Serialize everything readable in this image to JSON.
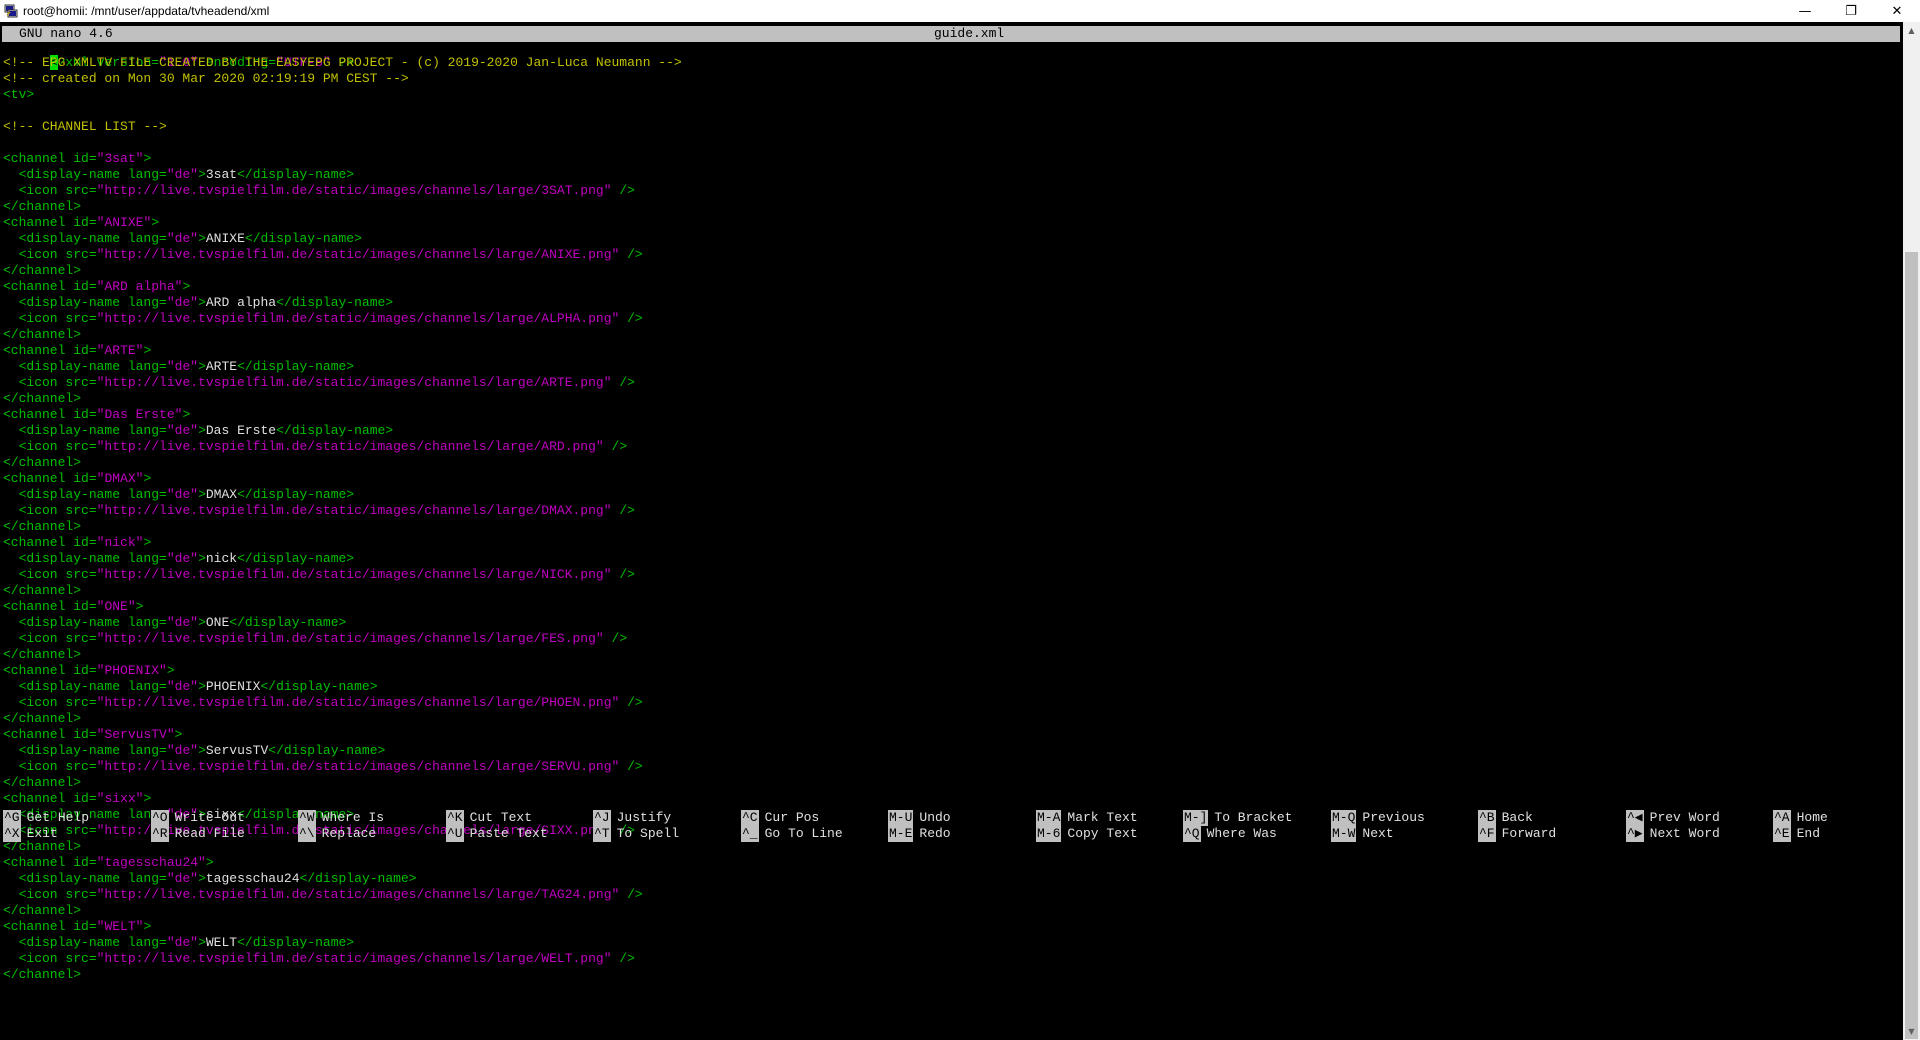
{
  "window": {
    "title": "root@homii: /mnt/user/appdata/tvheadend/xml",
    "minimize_glyph": "—",
    "maximize_glyph": "❐",
    "close_glyph": "✕"
  },
  "nano": {
    "version_label": "GNU nano 4.6",
    "filename": "guide.xml"
  },
  "file": {
    "xml_decl": {
      "cursor_char": "<",
      "pi": "?xml",
      "version_attr": " version=",
      "version_val": "\"1.0\"",
      "encoding_attr": " encoding=",
      "encoding_val": "\"UTF-8\"",
      "close": " ?>"
    },
    "comment1": "<!-- EPG XMLTV FILE CREATED BY THE EASYEPG PROJECT - (c) 2019-2020 Jan-Luca Neumann -->",
    "comment2": "<!-- created on Mon 30 Mar 2020 02:19:19 PM CEST -->",
    "tv_open": "<tv>",
    "comment3": "<!-- CHANNEL LIST -->",
    "channels": [
      {
        "id": "\"3sat\"",
        "name": "3sat",
        "icon": "\"http://live.tvspielfilm.de/static/images/channels/large/3SAT.png\""
      },
      {
        "id": "\"ANIXE\"",
        "name": "ANIXE",
        "icon": "\"http://live.tvspielfilm.de/static/images/channels/large/ANIXE.png\""
      },
      {
        "id": "\"ARD alpha\"",
        "name": "ARD alpha",
        "icon": "\"http://live.tvspielfilm.de/static/images/channels/large/ALPHA.png\""
      },
      {
        "id": "\"ARTE\"",
        "name": "ARTE",
        "icon": "\"http://live.tvspielfilm.de/static/images/channels/large/ARTE.png\""
      },
      {
        "id": "\"Das Erste\"",
        "name": "Das Erste",
        "icon": "\"http://live.tvspielfilm.de/static/images/channels/large/ARD.png\""
      },
      {
        "id": "\"DMAX\"",
        "name": "DMAX",
        "icon": "\"http://live.tvspielfilm.de/static/images/channels/large/DMAX.png\""
      },
      {
        "id": "\"nick\"",
        "name": "nick",
        "icon": "\"http://live.tvspielfilm.de/static/images/channels/large/NICK.png\""
      },
      {
        "id": "\"ONE\"",
        "name": "ONE",
        "icon": "\"http://live.tvspielfilm.de/static/images/channels/large/FES.png\""
      },
      {
        "id": "\"PHOENIX\"",
        "name": "PHOENIX",
        "icon": "\"http://live.tvspielfilm.de/static/images/channels/large/PHOEN.png\""
      },
      {
        "id": "\"ServusTV\"",
        "name": "ServusTV",
        "icon": "\"http://live.tvspielfilm.de/static/images/channels/large/SERVU.png\""
      },
      {
        "id": "\"sixx\"",
        "name": "sixx",
        "icon": "\"http://live.tvspielfilm.de/static/images/channels/large/SIXX.png\""
      },
      {
        "id": "\"tagesschau24\"",
        "name": "tagesschau24",
        "icon": "\"http://live.tvspielfilm.de/static/images/channels/large/TAG24.png\""
      },
      {
        "id": "\"WELT\"",
        "name": "WELT",
        "icon": "\"http://live.tvspielfilm.de/static/images/channels/large/WELT.png\""
      }
    ],
    "syntax": {
      "channel_open": "<channel",
      "id_attr": " id=",
      "gt": ">",
      "display_open": "  <display-name",
      "lang_attr": " lang=",
      "lang_val": "\"de\"",
      "display_close": "</display-name>",
      "icon_open": "  <icon",
      "src_attr": " src=",
      "self_close": " />",
      "channel_close": "</channel>"
    }
  },
  "help": {
    "row1": [
      {
        "key": "^G",
        "label": "Get Help"
      },
      {
        "key": "^O",
        "label": "Write Out"
      },
      {
        "key": "^W",
        "label": "Where Is"
      },
      {
        "key": "^K",
        "label": "Cut Text"
      },
      {
        "key": "^J",
        "label": "Justify"
      },
      {
        "key": "^C",
        "label": "Cur Pos"
      },
      {
        "key": "M-U",
        "label": "Undo"
      },
      {
        "key": "M-A",
        "label": "Mark Text"
      },
      {
        "key": "M-]",
        "label": "To Bracket"
      },
      {
        "key": "M-Q",
        "label": "Previous"
      },
      {
        "key": "^B",
        "label": "Back"
      },
      {
        "key": "^◀",
        "label": "Prev Word"
      },
      {
        "key": "^A",
        "label": "Home"
      }
    ],
    "row2": [
      {
        "key": "^X",
        "label": "Exit"
      },
      {
        "key": "^R",
        "label": "Read File"
      },
      {
        "key": "^\\",
        "label": "Replace"
      },
      {
        "key": "^U",
        "label": "Paste Text"
      },
      {
        "key": "^T",
        "label": "To Spell"
      },
      {
        "key": "^_",
        "label": "Go To Line"
      },
      {
        "key": "M-E",
        "label": "Redo"
      },
      {
        "key": "M-6",
        "label": "Copy Text"
      },
      {
        "key": "^Q",
        "label": "Where Was"
      },
      {
        "key": "M-W",
        "label": "Next"
      },
      {
        "key": "^F",
        "label": "Forward"
      },
      {
        "key": "^▶",
        "label": "Next Word"
      },
      {
        "key": "^E",
        "label": "End"
      }
    ]
  },
  "scrollbar": {
    "up_glyph": "▲",
    "down_glyph": "▼"
  }
}
